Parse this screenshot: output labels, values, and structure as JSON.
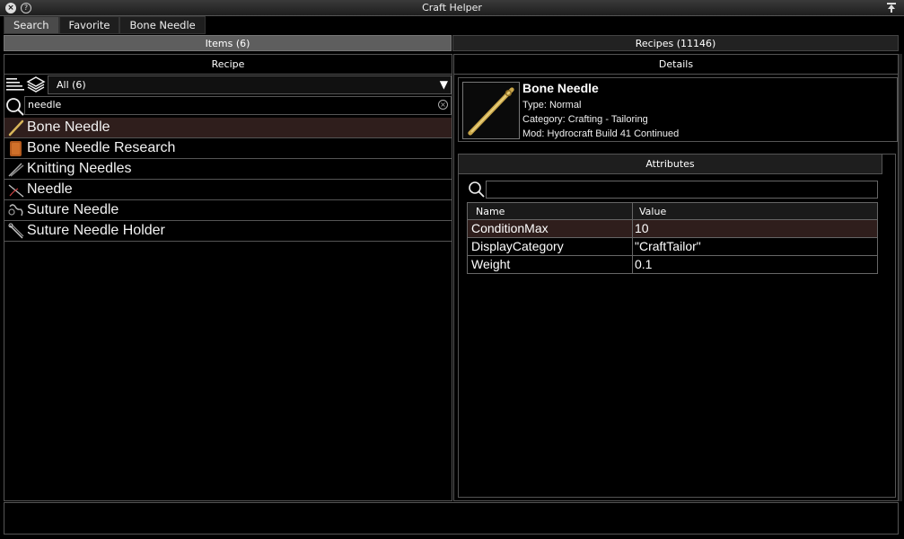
{
  "window": {
    "title": "Craft Helper"
  },
  "tabs": [
    {
      "label": "Search",
      "active": true
    },
    {
      "label": "Favorite",
      "active": false
    },
    {
      "label": "Bone Needle",
      "active": false
    }
  ],
  "modes": {
    "items": "Items (6)",
    "recipes": "Recipes (11146)"
  },
  "left_panel": {
    "header": "Recipe",
    "category": "All (6)",
    "search_value": "needle",
    "items": [
      {
        "label": "Bone Needle",
        "icon": "bone-needle-icon",
        "selected": true
      },
      {
        "label": "Bone Needle Research",
        "icon": "book-icon",
        "selected": false
      },
      {
        "label": "Knitting Needles",
        "icon": "knitting-needles-icon",
        "selected": false
      },
      {
        "label": "Needle",
        "icon": "needle-icon",
        "selected": false
      },
      {
        "label": "Suture Needle",
        "icon": "suture-needle-icon",
        "selected": false
      },
      {
        "label": "Suture Needle Holder",
        "icon": "needle-holder-icon",
        "selected": false
      }
    ]
  },
  "right_panel": {
    "header": "Details",
    "item": {
      "name": "Bone Needle",
      "type": "Type: Normal",
      "category": "Category: Crafting - Tailoring",
      "mod": "Mod: Hydrocraft Build 41 Continued"
    },
    "attributes": {
      "header": "Attributes",
      "columns": [
        "Name",
        "Value"
      ],
      "rows": [
        {
          "name": "ConditionMax",
          "value": "10"
        },
        {
          "name": "DisplayCategory",
          "value": "\"CraftTailor\""
        },
        {
          "name": "Weight",
          "value": "0.1"
        }
      ]
    }
  },
  "colors": {
    "selected_row": "#2f1e1c",
    "active_mode": "#5e5e5e",
    "background": "#000000"
  }
}
